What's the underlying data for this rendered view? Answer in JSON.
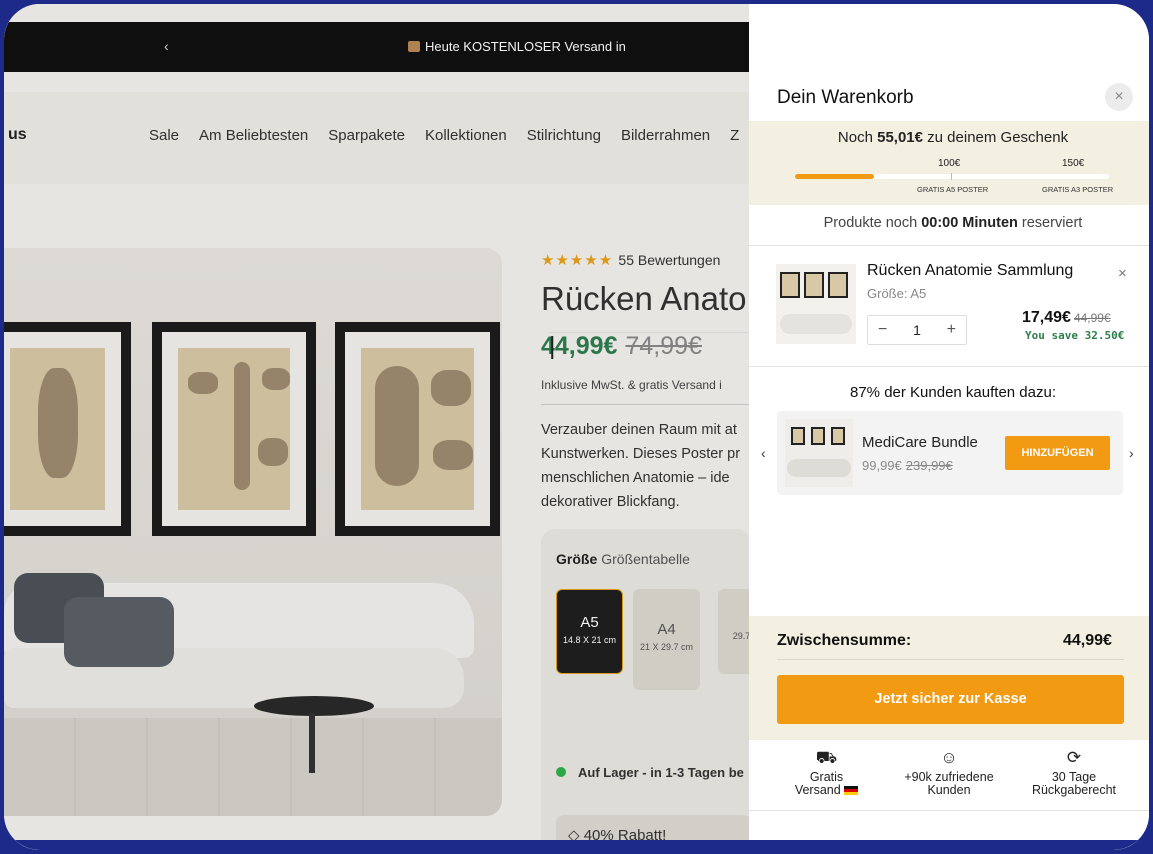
{
  "page": {
    "announcement": {
      "prev": "‹",
      "text": "Heute KOSTENLOSER Versand in"
    },
    "logo": "us",
    "nav": [
      "Sale",
      "Am Beliebtesten",
      "Sparpakete",
      "Kollektionen",
      "Stilrichtung",
      "Bilderrahmen",
      "Z"
    ],
    "product": {
      "stars": "★★★★★",
      "reviews": "55 Bewertungen",
      "title": "Rücken Anato",
      "price": "44,99€",
      "old_price": "74,99€",
      "price_sep": "|",
      "vat": "Inklusive MwSt. & gratis Versand i",
      "description": "Verzauber deinen Raum mit at Kunstwerken. Dieses Poster pr menschlichen Anatomie – ide dekorativer Blickfang.",
      "size_label": "Größe",
      "size_chart": "Größentabelle",
      "sizes": [
        {
          "name": "A5",
          "dims": "14.8 X 21 cm"
        },
        {
          "name": "A4",
          "dims": "21 X 29.7 cm"
        },
        {
          "name": "",
          "dims": "29.7"
        }
      ],
      "stock": "Auf Lager - in 1-3 Tagen be",
      "discount": "40% Rabatt!"
    }
  },
  "cart": {
    "title": "Dein Warenkorb",
    "close": "×",
    "gift": {
      "prefix": "Noch",
      "amount": "55,01€",
      "suffix": "zu deinem Geschenk",
      "milestone1": "100€",
      "milestone2": "150€",
      "reward1": "GRATIS A5 POSTER",
      "reward2": "GRATIS A3 POSTER",
      "progress": 0.25
    },
    "reserve": {
      "prefix": "Produkte noch",
      "time": "00:00 Minuten",
      "suffix": "reserviert"
    },
    "item": {
      "name": "Rücken Anatomie Sammlung",
      "remove": "×",
      "size": "Größe: A5",
      "qty": "1",
      "minus": "−",
      "plus": "+",
      "price": "17,49€",
      "old_price": "44,99€",
      "save": "You save 32.50€"
    },
    "upsell": {
      "title": "87% der Kunden kauften dazu:",
      "prev": "‹",
      "next": "›",
      "name": "MediCare Bundle",
      "price": "99,99€",
      "old_price": "239,99€",
      "button": "HINZUFÜGEN"
    },
    "subtotal_label": "Zwischensumme:",
    "subtotal_value": "44,99€",
    "checkout": "Jetzt sicher zur Kasse",
    "usps": [
      {
        "icon": "truck-icon",
        "line1": "Gratis",
        "line2": "Versand"
      },
      {
        "icon": "smile-icon",
        "line1": "+90k zufriedene",
        "line2": "Kunden"
      },
      {
        "icon": "refresh-icon",
        "line1": "30 Tage",
        "line2": "Rückgaberecht"
      }
    ]
  },
  "colors": {
    "accent": "#f29a12",
    "green": "#2e7d4f",
    "frame": "#1e2a8a",
    "cream": "#f3efe1"
  }
}
